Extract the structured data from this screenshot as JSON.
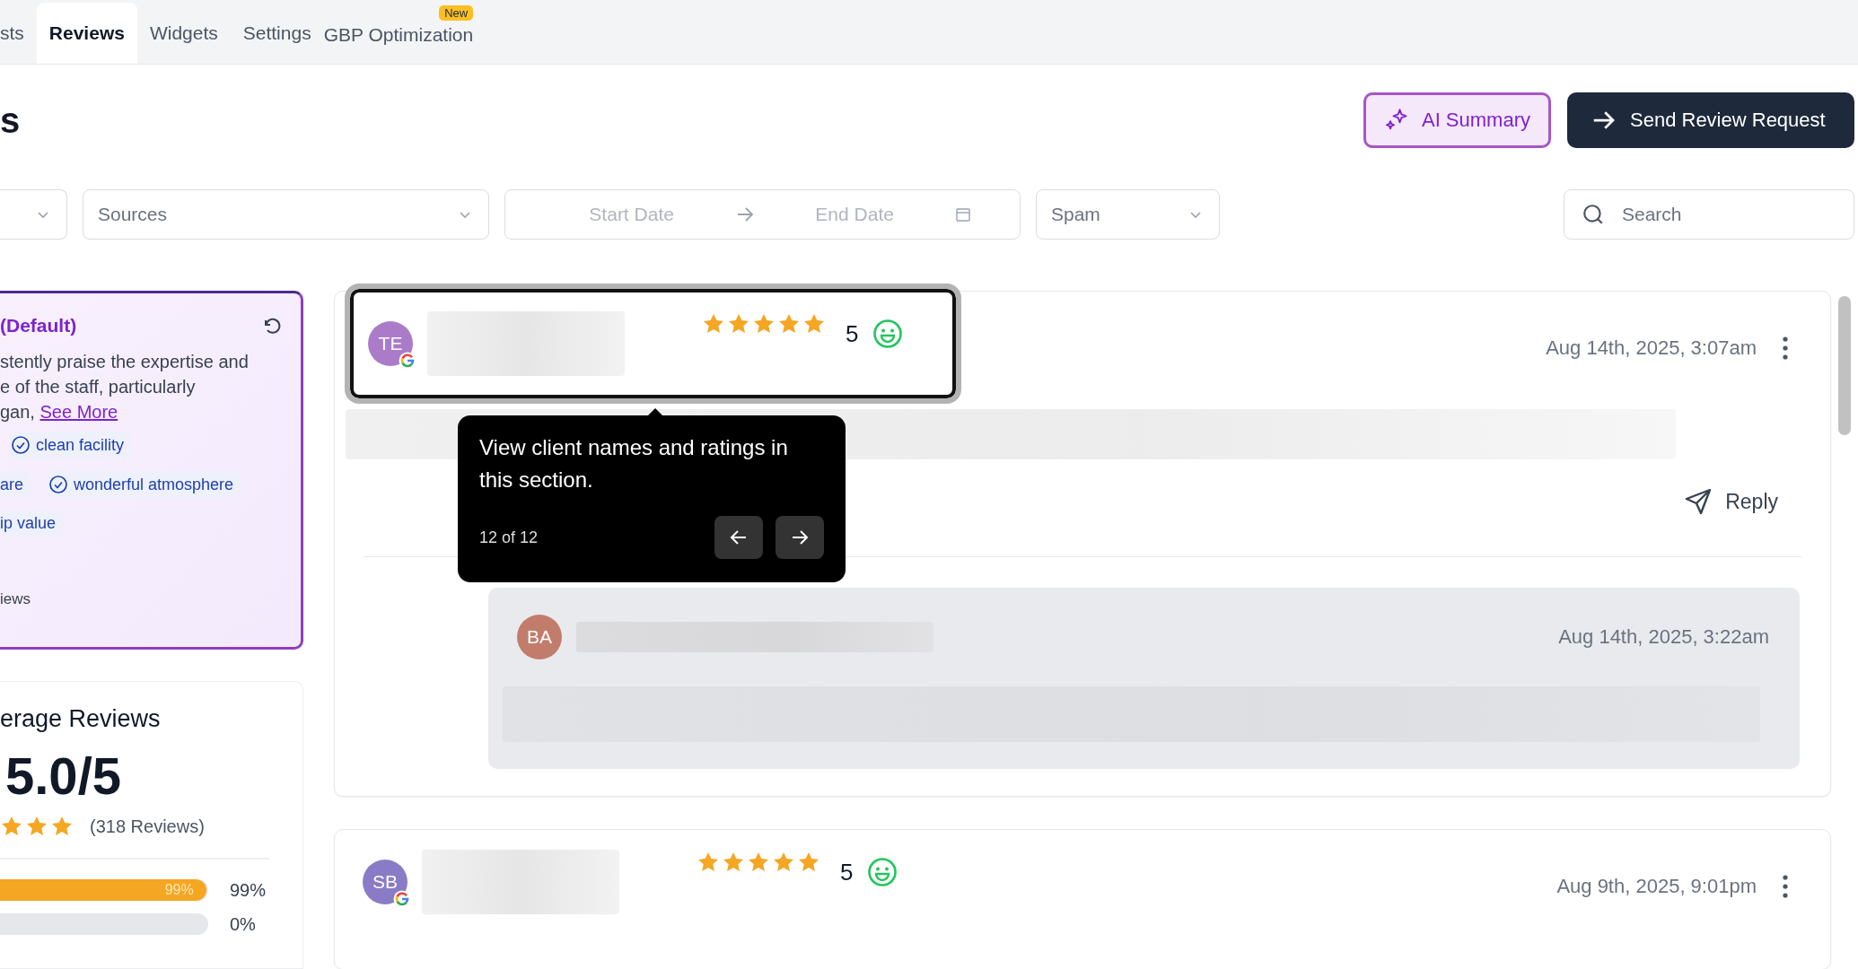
{
  "tabs": [
    {
      "label": "sts",
      "selected": false
    },
    {
      "label": "Reviews",
      "selected": true
    },
    {
      "label": "Widgets",
      "selected": false
    },
    {
      "label": "Settings",
      "selected": false
    },
    {
      "label": "GBP Optimization",
      "selected": false,
      "badge": "New"
    }
  ],
  "page_title": "s",
  "actions": [
    {
      "kind": "ai",
      "label": "AI Summary"
    },
    {
      "kind": "primary",
      "label": "Send Review Request"
    }
  ],
  "filters": [
    {
      "kind": "dropdown"
    },
    {
      "kind": "dropdown",
      "placeholder": "Sources"
    },
    {
      "kind": "daterange",
      "start_placeholder": "Start Date",
      "end_placeholder": "End Date"
    },
    {
      "kind": "dropdown",
      "placeholder": "Spam"
    }
  ],
  "search": {
    "placeholder": "Search"
  },
  "ai_summary": {
    "title": "(Default)",
    "text": "stently praise the expertise and\ne of the staff, particularly\ngan, ",
    "link": "See More",
    "tag_rows": [
      [
        {
          "label": "clean facility",
          "icon": true
        }
      ],
      [
        {
          "label": "are",
          "icon": false
        },
        {
          "label": "wonderful atmosphere",
          "icon": true
        }
      ],
      [
        {
          "label": "ip value",
          "icon": false
        }
      ]
    ],
    "footer": "iews"
  },
  "average": {
    "title": "erage Reviews",
    "score": "5.0/5",
    "stars": 3,
    "count": "(318 Reviews)",
    "bars": [
      {
        "level": 0.99,
        "inner_label": "99%",
        "label": "99%"
      },
      {
        "level": 0,
        "label": "0%"
      }
    ]
  },
  "reviews": [
    {
      "initials": "TE",
      "color": "#a97bc9",
      "source_badge": true,
      "highlighted": true,
      "stars": 5,
      "rating": "5",
      "satisfied": true,
      "date": "Aug 14th, 2025, 3:07am",
      "reply_label": "Reply",
      "responses": [
        {
          "initials": "BA",
          "color": "#c27c6c",
          "date": "Aug 14th, 2025, 3:22am"
        }
      ]
    },
    {
      "initials": "SB",
      "color": "#8a7bc6",
      "source_badge": true,
      "highlighted": false,
      "stars": 5,
      "rating": "5",
      "satisfied": true,
      "date": "Aug 9th, 2025, 9:01pm"
    }
  ],
  "tour_tooltip": {
    "text": "View client names and ratings in this section.",
    "step": "12 of 12"
  }
}
